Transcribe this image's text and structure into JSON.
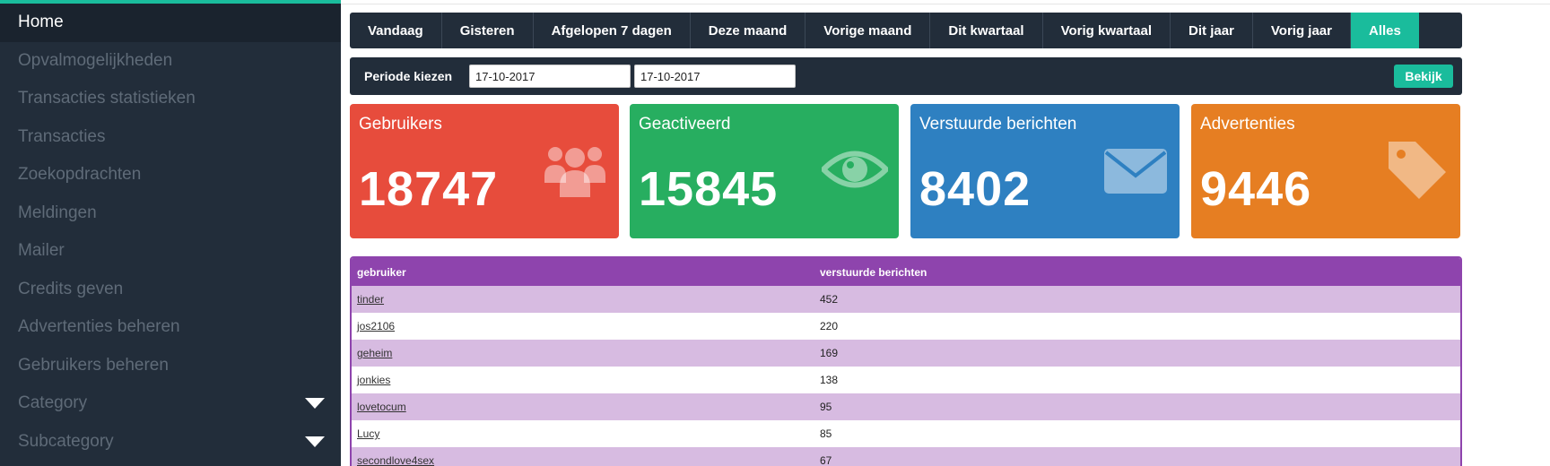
{
  "sidebar": {
    "items": [
      {
        "label": "Home",
        "active": true
      },
      {
        "label": "Opvalmogelijkheden"
      },
      {
        "label": "Transacties statistieken"
      },
      {
        "label": "Transacties"
      },
      {
        "label": "Zoekopdrachten"
      },
      {
        "label": "Meldingen"
      },
      {
        "label": "Mailer"
      },
      {
        "label": "Credits geven"
      },
      {
        "label": "Advertenties beheren"
      },
      {
        "label": "Gebruikers beheren"
      },
      {
        "label": "Category",
        "dropdown": true
      },
      {
        "label": "Subcategory",
        "dropdown": true
      }
    ]
  },
  "tabs": [
    {
      "label": "Vandaag"
    },
    {
      "label": "Gisteren"
    },
    {
      "label": "Afgelopen 7 dagen"
    },
    {
      "label": "Deze maand"
    },
    {
      "label": "Vorige maand"
    },
    {
      "label": "Dit kwartaal"
    },
    {
      "label": "Vorig kwartaal"
    },
    {
      "label": "Dit jaar"
    },
    {
      "label": "Vorig jaar"
    },
    {
      "label": "Alles",
      "active": true
    }
  ],
  "period": {
    "label": "Periode kiezen",
    "from": "17-10-2017",
    "to": "17-10-2017",
    "button": "Bekijk"
  },
  "cards": [
    {
      "title": "Gebruikers",
      "value": "18747",
      "color": "#e74c3c",
      "icon": "users-icon"
    },
    {
      "title": "Geactiveerd",
      "value": "15845",
      "color": "#27ae60",
      "icon": "eye-icon"
    },
    {
      "title": "Verstuurde berichten",
      "value": "8402",
      "color": "#2e80c1",
      "icon": "envelope-icon"
    },
    {
      "title": "Advertenties",
      "value": "9446",
      "color": "#e67e22",
      "icon": "tag-icon"
    }
  ],
  "table": {
    "headers": [
      "gebruiker",
      "verstuurde berichten"
    ],
    "rows": [
      [
        "tinder",
        "452"
      ],
      [
        "jos2106",
        "220"
      ],
      [
        "geheim",
        "169"
      ],
      [
        "jonkies",
        "138"
      ],
      [
        "lovetocum",
        "95"
      ],
      [
        "Lucy",
        "85"
      ],
      [
        "secondlove4sex",
        "67"
      ]
    ]
  },
  "colors": {
    "accent": "#1abc9c",
    "sidebar_bg": "#222d3a",
    "table_header": "#8e44ad"
  }
}
